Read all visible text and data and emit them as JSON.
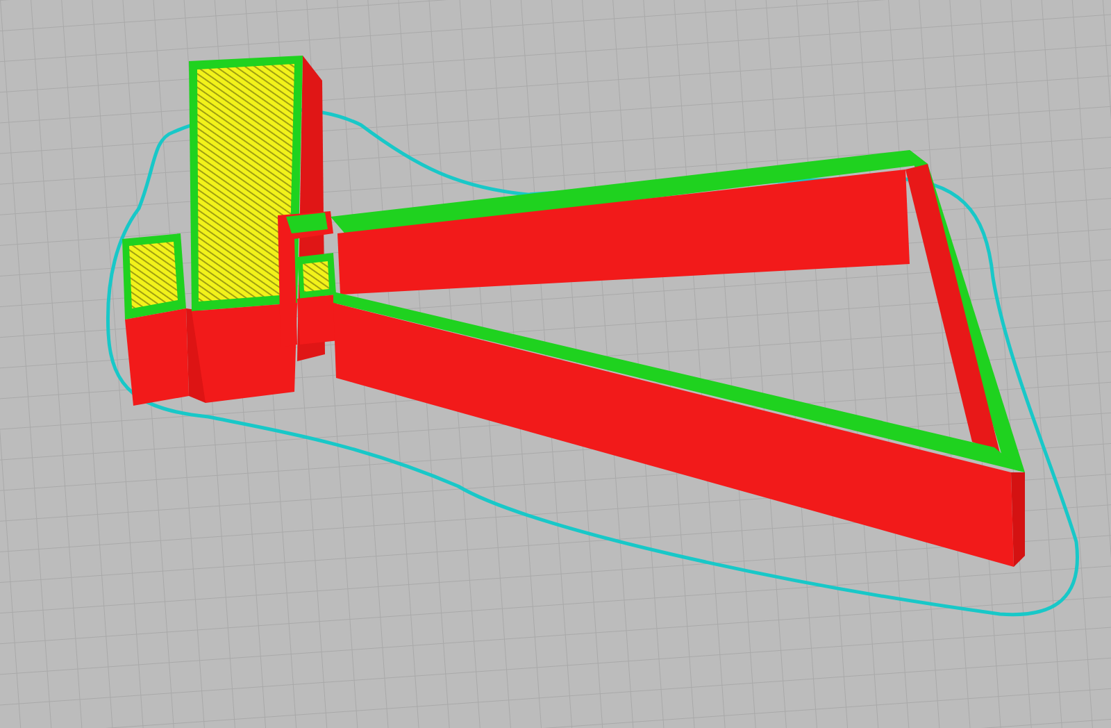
{
  "preview": {
    "kind": "layer-view"
  }
}
